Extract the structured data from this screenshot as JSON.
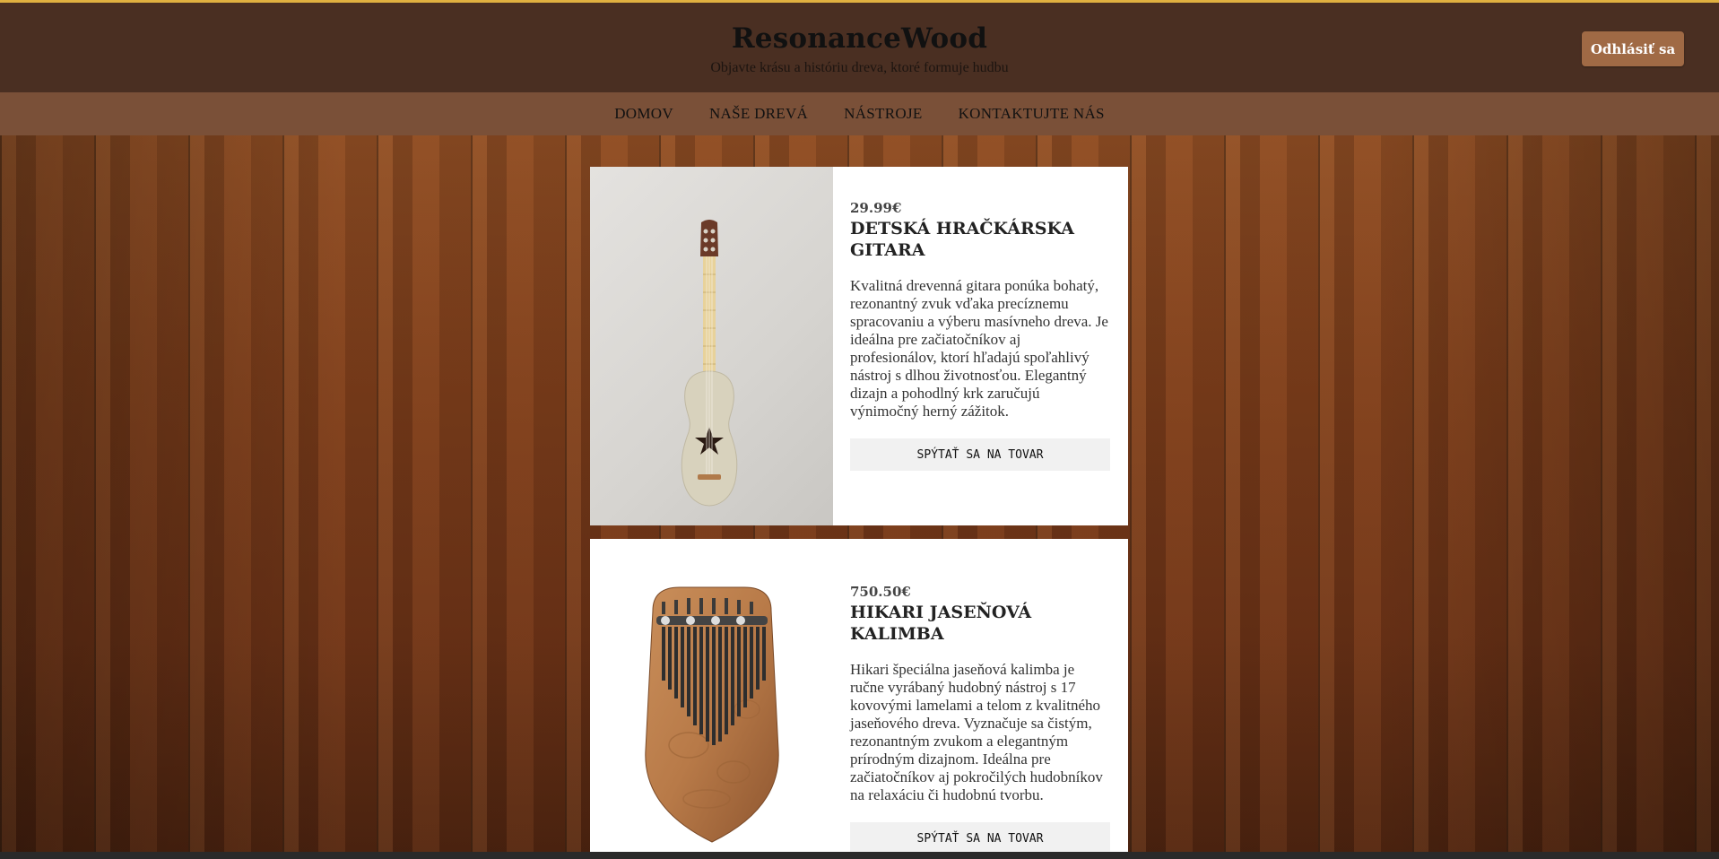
{
  "header": {
    "title": "ResonanceWood",
    "tagline": "Objavte krásu a históriu dreva, ktoré formuje hudbu",
    "logout_label": "Odhlásiť sa"
  },
  "nav": {
    "items": [
      {
        "label": "DOMOV"
      },
      {
        "label": "NAŠE DREVÁ"
      },
      {
        "label": "NÁSTROJE"
      },
      {
        "label": "KONTAKTUJTE NÁS"
      }
    ]
  },
  "products": [
    {
      "price": "29.99€",
      "title": "DETSKÁ HRAČKÁRSKA GITARA",
      "description": "Kvalitná drevenná gitara ponúka bohatý, rezonantný zvuk vďaka precíznemu spracovaniu a výberu masívneho dreva. Je ideálna pre začiatočníkov aj profesionálov, ktorí hľadajú spoľahlivý nástroj s dlhou životnosťou. Elegantný dizajn a pohodlný krk zaručujú výnimočný herný zážitok.",
      "button_label": "SPÝTAŤ SA NA TOVAR",
      "image": "toy-guitar"
    },
    {
      "price": "750.50€",
      "title": "HIKARI JASEŇOVÁ KALIMBA",
      "description": "Hikari špeciálna jaseňová kalimba je ručne vyrábaný hudobný nástroj s 17 kovovými lamelami a telom z kvalitného jaseňového dreva. Vyznačuje sa čistým, rezonantným zvukom a elegantným prírodným dizajnom. Ideálna pre začiatočníkov aj pokročilých hudobníkov na relaxáciu či hudobnú tvorbu.",
      "button_label": "SPÝTAŤ SA NA TOVAR",
      "image": "kalimba"
    }
  ],
  "colors": {
    "header_bg": "#4a2f22",
    "nav_bg": "#7a5038",
    "accent_border": "#e0b040",
    "logout_bg": "#a06a45"
  }
}
